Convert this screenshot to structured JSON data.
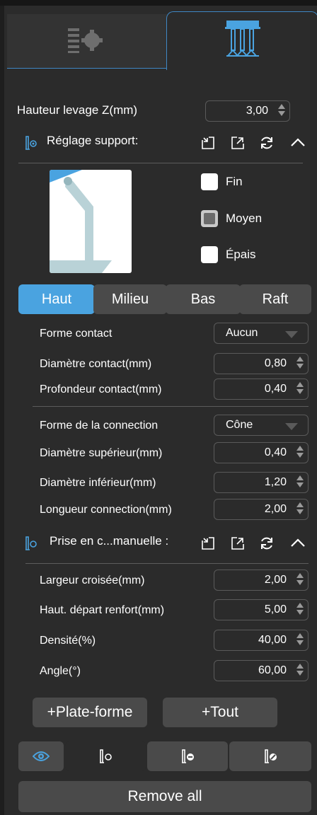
{
  "tabs": [
    {
      "icon": "settings-list-icon"
    },
    {
      "icon": "support-columns-icon"
    }
  ],
  "lift": {
    "label": "Hauteur levage Z(mm)",
    "value": "3,00"
  },
  "support_section": {
    "title": "Réglage support:"
  },
  "size_options": [
    {
      "label": "Fin",
      "checked": false
    },
    {
      "label": "Moyen",
      "checked": true
    },
    {
      "label": "Épais",
      "checked": false
    }
  ],
  "segments": [
    {
      "label": "Haut",
      "active": true
    },
    {
      "label": "Milieu",
      "active": false
    },
    {
      "label": "Bas",
      "active": false
    },
    {
      "label": "Raft",
      "active": false
    }
  ],
  "contact": [
    {
      "label": "Forme contact",
      "value": "Aucun",
      "kind": "combo"
    },
    {
      "label": "Diamètre contact(mm)",
      "value": "0,80",
      "kind": "spin"
    },
    {
      "label": "Profondeur contact(mm)",
      "value": "0,40",
      "kind": "spin"
    }
  ],
  "connection": [
    {
      "label": "Forme de la connection",
      "value": "Cône",
      "kind": "combo"
    },
    {
      "label": "Diamètre supérieur(mm)",
      "value": "0,40",
      "kind": "spin"
    },
    {
      "label": "Diamètre inférieur(mm)",
      "value": "1,20",
      "kind": "spin"
    },
    {
      "label": "Longueur connection(mm)",
      "value": "2,00",
      "kind": "spin"
    }
  ],
  "manual_section": {
    "title": "Prise en c...manuelle :"
  },
  "manual": [
    {
      "label": "Largeur croisée(mm)",
      "value": "2,00"
    },
    {
      "label": "Haut. départ renfort(mm)",
      "value": "5,00"
    },
    {
      "label": "Densité(%)",
      "value": "40,00"
    },
    {
      "label": "Angle(°)",
      "value": "60,00"
    }
  ],
  "actions": {
    "platform": "+Plate-forme",
    "all": "+Tout"
  },
  "bottom_tools": [
    "eye-icon",
    "support-add-icon",
    "support-remove-icon",
    "support-edit-icon"
  ],
  "remove_all": "Remove all",
  "colors": {
    "accent": "#4aa3e0",
    "panel": "#2b2b2b",
    "button": "#4a4a4a"
  }
}
